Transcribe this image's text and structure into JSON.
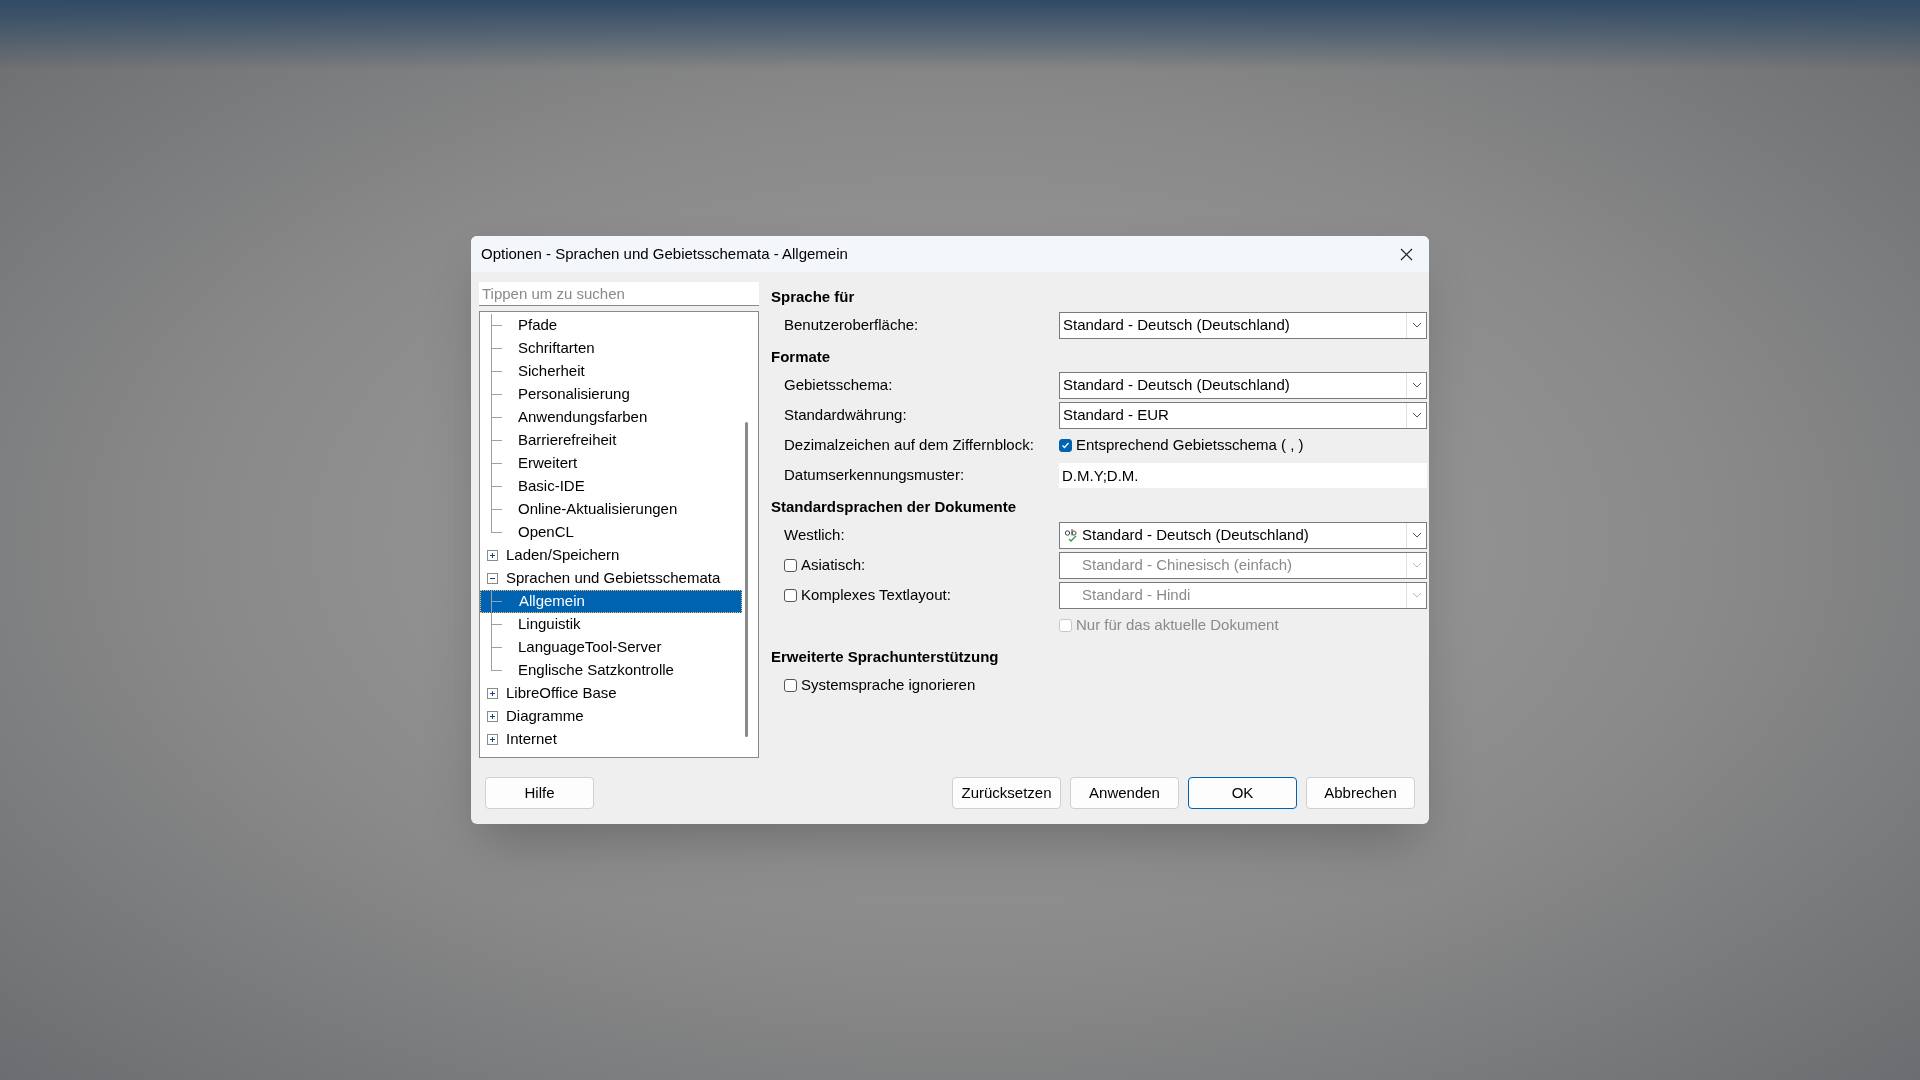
{
  "window": {
    "title": "Optionen - Sprachen und Gebietsschemata - Allgemein"
  },
  "search": {
    "placeholder": "Tippen um zu suchen"
  },
  "tree": {
    "items": [
      {
        "children": [
          {
            "label": "Pfade",
            "selected": false
          },
          {
            "label": "Schriftarten",
            "selected": false
          },
          {
            "label": "Sicherheit",
            "selected": false
          },
          {
            "label": "Personalisierung",
            "selected": false
          },
          {
            "label": "Anwendungsfarben",
            "selected": false
          },
          {
            "label": "Barrierefreiheit",
            "selected": false
          },
          {
            "label": "Erweitert",
            "selected": false
          },
          {
            "label": "Basic-IDE",
            "selected": false
          },
          {
            "label": "Online-Aktualisierungen",
            "selected": false
          },
          {
            "label": "OpenCL",
            "selected": false
          }
        ]
      },
      {
        "label": "Laden/Speichern",
        "expanded": false,
        "selected": false
      },
      {
        "label": "Sprachen und Gebietsschemata",
        "expanded": true,
        "selected": false,
        "children": [
          {
            "label": "Allgemein",
            "selected": true
          },
          {
            "label": "Linguistik",
            "selected": false
          },
          {
            "label": "LanguageTool-Server",
            "selected": false
          },
          {
            "label": "Englische Satzkontrolle",
            "selected": false
          }
        ]
      },
      {
        "label": "LibreOffice Base",
        "expanded": false,
        "selected": false
      },
      {
        "label": "Diagramme",
        "expanded": false,
        "selected": false
      },
      {
        "label": "Internet",
        "expanded": false,
        "selected": false
      }
    ]
  },
  "sections": [
    {
      "title": "Sprache für",
      "rows": [
        {
          "kind": "combo",
          "label": "Benutzeroberfläche:",
          "value": "Standard - Deutsch (Deutschland)",
          "disabled": false
        }
      ]
    },
    {
      "title": "Formate",
      "rows": [
        {
          "kind": "combo",
          "label": "Gebietsschema:",
          "value": "Standard - Deutsch (Deutschland)",
          "disabled": false
        },
        {
          "kind": "combo",
          "label": "Standardwährung:",
          "value": "Standard - EUR",
          "disabled": false
        },
        {
          "kind": "checkbox",
          "label": "Dezimalzeichen auf dem Ziffernblock:",
          "option": "Entsprechend Gebietsschema ( , )",
          "checked": true
        },
        {
          "kind": "text",
          "label": "Datumserkennungsmuster:",
          "value": "D.M.Y;D.M."
        }
      ]
    },
    {
      "title": "Standardsprachen der Dokumente",
      "rows": [
        {
          "kind": "combo",
          "label": "Westlich:",
          "value": "Standard - Deutsch (Deutschland)",
          "disabled": false,
          "spellcheck": true
        },
        {
          "kind": "combo",
          "label": "Asiatisch:",
          "checked": false,
          "value": "Standard - Chinesisch (einfach)",
          "disabled": true
        },
        {
          "kind": "combo",
          "label": "Komplexes Textlayout:",
          "checked": false,
          "value": "Standard - Hindi",
          "disabled": true
        },
        {
          "kind": "checkbox",
          "option": "Nur für das aktuelle Dokument",
          "checked": false,
          "disabled": true
        }
      ]
    },
    {
      "title": "Erweiterte Sprachunterstützung",
      "rows": [
        {
          "kind": "check",
          "label": "Systemsprache ignorieren",
          "checked": false
        }
      ]
    }
  ],
  "buttons": [
    {
      "label": "Hilfe",
      "kind": "help",
      "default": false
    },
    {
      "label": "Zurücksetzen",
      "kind": "action",
      "default": false
    },
    {
      "label": "Anwenden",
      "kind": "action",
      "default": false
    },
    {
      "label": "OK",
      "kind": "action",
      "default": true
    },
    {
      "label": "Abbrechen",
      "kind": "action",
      "default": false
    }
  ]
}
